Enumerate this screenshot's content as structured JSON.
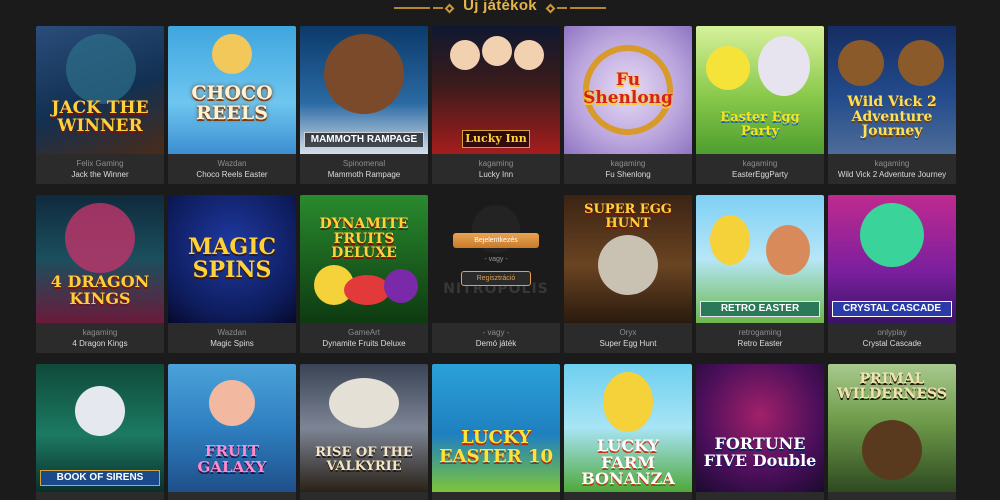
{
  "section": {
    "title": "Új játékok"
  },
  "demo_card": {
    "login_label": "Bejelentkezés",
    "or_label": "- vagy -",
    "register_label": "Regisztráció",
    "provider": "- vagy -",
    "name": "Demó játék",
    "ghost_text": "NITROPOLIS"
  },
  "games": [
    {
      "provider": "Felix Gaming",
      "name": "Jack the Winner",
      "art": "JACK THE WINNER"
    },
    {
      "provider": "Wazdan",
      "name": "Choco Reels Easter",
      "art": "CHOCO REELS"
    },
    {
      "provider": "Spinomenal",
      "name": "Mammoth Rampage",
      "art": "MAMMOTH RAMPAGE"
    },
    {
      "provider": "kagaming",
      "name": "Lucky Inn",
      "art": "Lucky Inn"
    },
    {
      "provider": "kagaming",
      "name": "Fu Shenlong",
      "art": "Fu Shenlong"
    },
    {
      "provider": "kagaming",
      "name": "EasterEggParty",
      "art": "Easter Egg Party"
    },
    {
      "provider": "kagaming",
      "name": "Wild Vick 2 Adventure Journey",
      "art": "Wild Vick 2 Adventure Journey"
    },
    {
      "provider": "kagaming",
      "name": "4 Dragon Kings",
      "art": "4 DRAGON KINGS"
    },
    {
      "provider": "Wazdan",
      "name": "Magic Spins",
      "art": "MAGIC SPINS"
    },
    {
      "provider": "GameArt",
      "name": "Dynamite Fruits Deluxe",
      "art": "DYNAMITE FRUITS DELUXE"
    },
    {
      "provider": "Oryx",
      "name": "Super Egg Hunt",
      "art": "SUPER EGG HUNT"
    },
    {
      "provider": "retrogaming",
      "name": "Retro Easter",
      "art": "RETRO EASTER"
    },
    {
      "provider": "onlyplay",
      "name": "Crystal Cascade",
      "art": "CRYSTAL CASCADE"
    },
    {
      "art": "BOOK OF SIRENS"
    },
    {
      "art": "FRUIT GALAXY"
    },
    {
      "art": "RISE OF THE VALKYRIE"
    },
    {
      "art": "LUCKY EASTER 10"
    },
    {
      "art": "LUCKY FARM BONANZA"
    },
    {
      "art": "FORTUNE FIVE Double"
    },
    {
      "art": "PRIMAL WILDERNESS"
    }
  ]
}
